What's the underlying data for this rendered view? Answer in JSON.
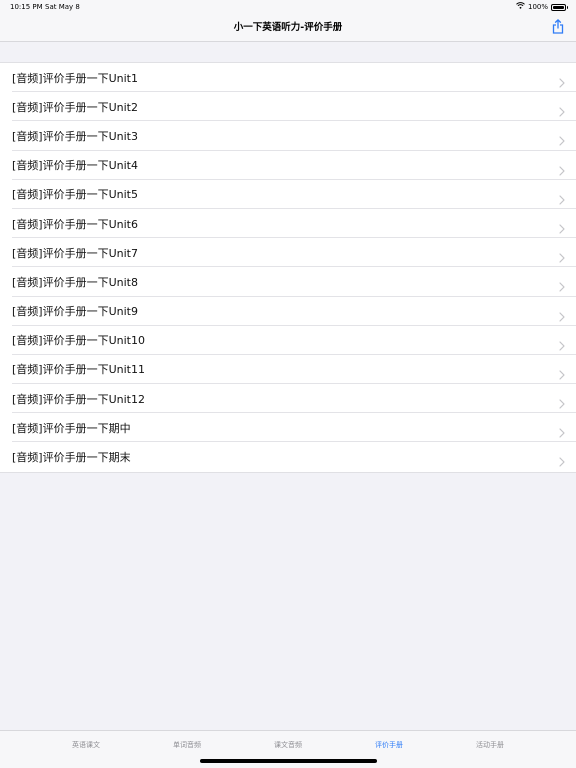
{
  "status": {
    "time": "10:15 PM",
    "date": "Sat May 8",
    "battery_text": "100%",
    "battery_level": 1.0
  },
  "nav": {
    "title": "小一下英语听力-评价手册",
    "share_icon": "share-icon"
  },
  "list": {
    "items": [
      {
        "label": "[音频]评价手册一下Unit1"
      },
      {
        "label": "[音频]评价手册一下Unit2"
      },
      {
        "label": "[音频]评价手册一下Unit3"
      },
      {
        "label": "[音频]评价手册一下Unit4"
      },
      {
        "label": "[音频]评价手册一下Unit5"
      },
      {
        "label": "[音频]评价手册一下Unit6"
      },
      {
        "label": "[音频]评价手册一下Unit7"
      },
      {
        "label": "[音频]评价手册一下Unit8"
      },
      {
        "label": "[音频]评价手册一下Unit9"
      },
      {
        "label": "[音频]评价手册一下Unit10"
      },
      {
        "label": "[音频]评价手册一下Unit11"
      },
      {
        "label": "[音频]评价手册一下Unit12"
      },
      {
        "label": "[音频]评价手册一下期中"
      },
      {
        "label": "[音频]评价手册一下期末"
      }
    ]
  },
  "tabs": [
    {
      "label": "英语课文"
    },
    {
      "label": "单词音频"
    },
    {
      "label": "课文音频"
    },
    {
      "label": "评价手册"
    },
    {
      "label": "活动手册"
    }
  ],
  "active_tab": 3,
  "colors": {
    "accent": "#2f7cf6",
    "inactive_tab": "#8e8e93",
    "background": "#f2f2f7"
  }
}
